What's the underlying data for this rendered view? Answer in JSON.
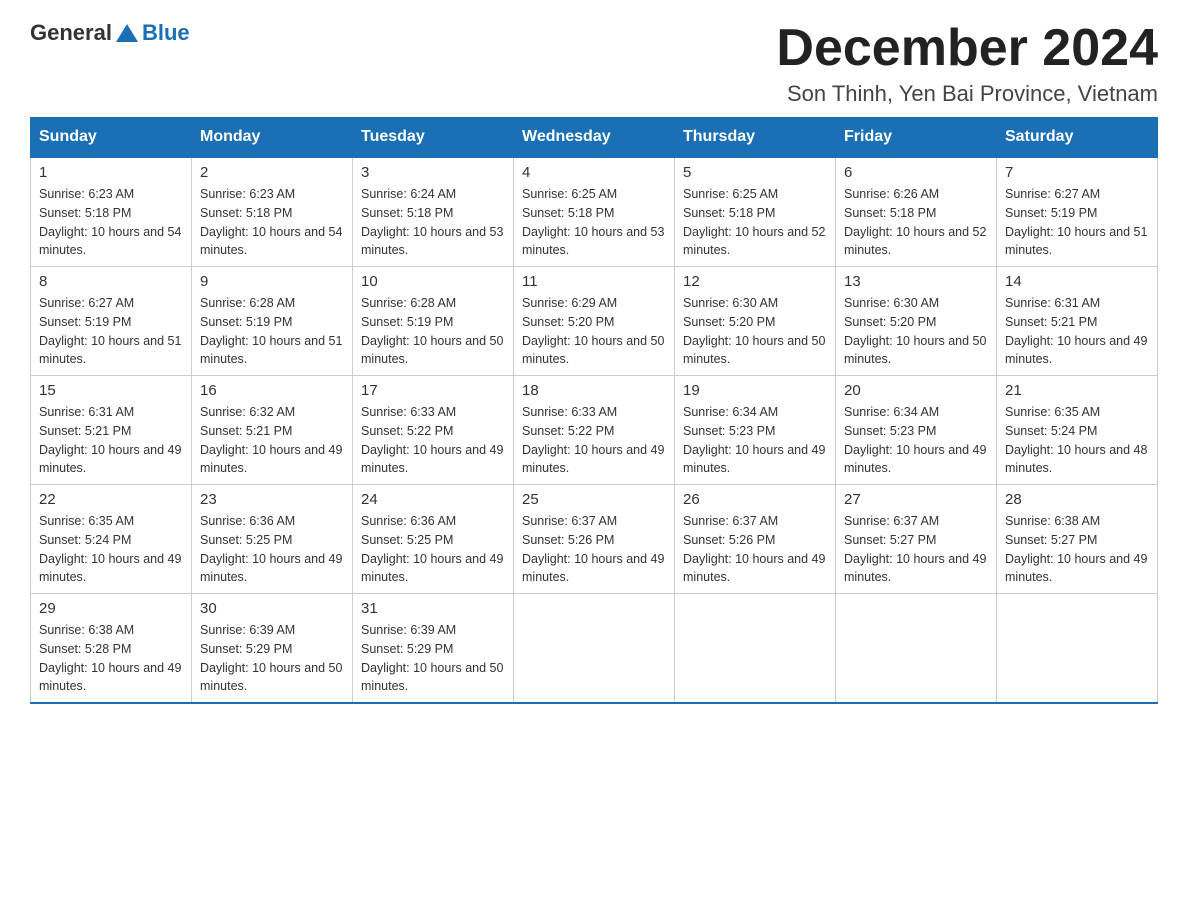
{
  "header": {
    "logo_general": "General",
    "logo_blue": "Blue",
    "month_title": "December 2024",
    "location": "Son Thinh, Yen Bai Province, Vietnam"
  },
  "days_of_week": [
    "Sunday",
    "Monday",
    "Tuesday",
    "Wednesday",
    "Thursday",
    "Friday",
    "Saturday"
  ],
  "weeks": [
    [
      {
        "day": "1",
        "sunrise": "6:23 AM",
        "sunset": "5:18 PM",
        "daylight": "10 hours and 54 minutes."
      },
      {
        "day": "2",
        "sunrise": "6:23 AM",
        "sunset": "5:18 PM",
        "daylight": "10 hours and 54 minutes."
      },
      {
        "day": "3",
        "sunrise": "6:24 AM",
        "sunset": "5:18 PM",
        "daylight": "10 hours and 53 minutes."
      },
      {
        "day": "4",
        "sunrise": "6:25 AM",
        "sunset": "5:18 PM",
        "daylight": "10 hours and 53 minutes."
      },
      {
        "day": "5",
        "sunrise": "6:25 AM",
        "sunset": "5:18 PM",
        "daylight": "10 hours and 52 minutes."
      },
      {
        "day": "6",
        "sunrise": "6:26 AM",
        "sunset": "5:18 PM",
        "daylight": "10 hours and 52 minutes."
      },
      {
        "day": "7",
        "sunrise": "6:27 AM",
        "sunset": "5:19 PM",
        "daylight": "10 hours and 51 minutes."
      }
    ],
    [
      {
        "day": "8",
        "sunrise": "6:27 AM",
        "sunset": "5:19 PM",
        "daylight": "10 hours and 51 minutes."
      },
      {
        "day": "9",
        "sunrise": "6:28 AM",
        "sunset": "5:19 PM",
        "daylight": "10 hours and 51 minutes."
      },
      {
        "day": "10",
        "sunrise": "6:28 AM",
        "sunset": "5:19 PM",
        "daylight": "10 hours and 50 minutes."
      },
      {
        "day": "11",
        "sunrise": "6:29 AM",
        "sunset": "5:20 PM",
        "daylight": "10 hours and 50 minutes."
      },
      {
        "day": "12",
        "sunrise": "6:30 AM",
        "sunset": "5:20 PM",
        "daylight": "10 hours and 50 minutes."
      },
      {
        "day": "13",
        "sunrise": "6:30 AM",
        "sunset": "5:20 PM",
        "daylight": "10 hours and 50 minutes."
      },
      {
        "day": "14",
        "sunrise": "6:31 AM",
        "sunset": "5:21 PM",
        "daylight": "10 hours and 49 minutes."
      }
    ],
    [
      {
        "day": "15",
        "sunrise": "6:31 AM",
        "sunset": "5:21 PM",
        "daylight": "10 hours and 49 minutes."
      },
      {
        "day": "16",
        "sunrise": "6:32 AM",
        "sunset": "5:21 PM",
        "daylight": "10 hours and 49 minutes."
      },
      {
        "day": "17",
        "sunrise": "6:33 AM",
        "sunset": "5:22 PM",
        "daylight": "10 hours and 49 minutes."
      },
      {
        "day": "18",
        "sunrise": "6:33 AM",
        "sunset": "5:22 PM",
        "daylight": "10 hours and 49 minutes."
      },
      {
        "day": "19",
        "sunrise": "6:34 AM",
        "sunset": "5:23 PM",
        "daylight": "10 hours and 49 minutes."
      },
      {
        "day": "20",
        "sunrise": "6:34 AM",
        "sunset": "5:23 PM",
        "daylight": "10 hours and 49 minutes."
      },
      {
        "day": "21",
        "sunrise": "6:35 AM",
        "sunset": "5:24 PM",
        "daylight": "10 hours and 48 minutes."
      }
    ],
    [
      {
        "day": "22",
        "sunrise": "6:35 AM",
        "sunset": "5:24 PM",
        "daylight": "10 hours and 49 minutes."
      },
      {
        "day": "23",
        "sunrise": "6:36 AM",
        "sunset": "5:25 PM",
        "daylight": "10 hours and 49 minutes."
      },
      {
        "day": "24",
        "sunrise": "6:36 AM",
        "sunset": "5:25 PM",
        "daylight": "10 hours and 49 minutes."
      },
      {
        "day": "25",
        "sunrise": "6:37 AM",
        "sunset": "5:26 PM",
        "daylight": "10 hours and 49 minutes."
      },
      {
        "day": "26",
        "sunrise": "6:37 AM",
        "sunset": "5:26 PM",
        "daylight": "10 hours and 49 minutes."
      },
      {
        "day": "27",
        "sunrise": "6:37 AM",
        "sunset": "5:27 PM",
        "daylight": "10 hours and 49 minutes."
      },
      {
        "day": "28",
        "sunrise": "6:38 AM",
        "sunset": "5:27 PM",
        "daylight": "10 hours and 49 minutes."
      }
    ],
    [
      {
        "day": "29",
        "sunrise": "6:38 AM",
        "sunset": "5:28 PM",
        "daylight": "10 hours and 49 minutes."
      },
      {
        "day": "30",
        "sunrise": "6:39 AM",
        "sunset": "5:29 PM",
        "daylight": "10 hours and 50 minutes."
      },
      {
        "day": "31",
        "sunrise": "6:39 AM",
        "sunset": "5:29 PM",
        "daylight": "10 hours and 50 minutes."
      },
      null,
      null,
      null,
      null
    ]
  ]
}
